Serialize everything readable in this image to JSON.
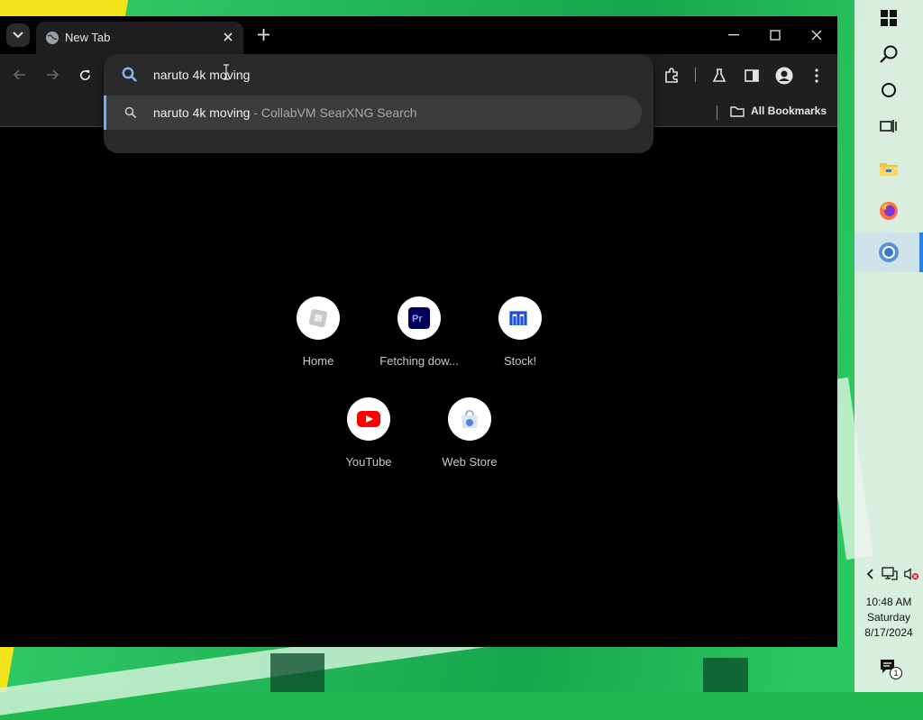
{
  "browser": {
    "tab": {
      "title": "New Tab"
    },
    "omnibox": {
      "value": "naruto 4k moving",
      "suggestion": {
        "query": "naruto 4k moving",
        "separator": " - ",
        "provider": "CollabVM SearXNG Search"
      }
    },
    "bookmarks_bar": {
      "all_bookmarks_label": "All Bookmarks"
    },
    "shortcuts": [
      {
        "label": "Home",
        "icon": "roblox-icon"
      },
      {
        "label": "Fetching dow...",
        "icon": "premiere-pro-icon"
      },
      {
        "label": "Stock!",
        "icon": "stock-icon"
      },
      {
        "label": "YouTube",
        "icon": "youtube-icon"
      },
      {
        "label": "Web Store",
        "icon": "web-store-icon"
      }
    ]
  },
  "taskbar": {
    "clock": {
      "time": "10:48 AM",
      "day": "Saturday",
      "date": "8/17/2024"
    },
    "notification_count": "1"
  },
  "colors": {
    "accent": "#7aa7ff",
    "search_icon": "#8ab4f8",
    "youtube_red": "#ff0000",
    "premiere_bg": "#00005b",
    "premiere_text": "#9999ff",
    "stock_blue": "#1a4ed8",
    "taskbar_active": "#2f7ee6"
  }
}
